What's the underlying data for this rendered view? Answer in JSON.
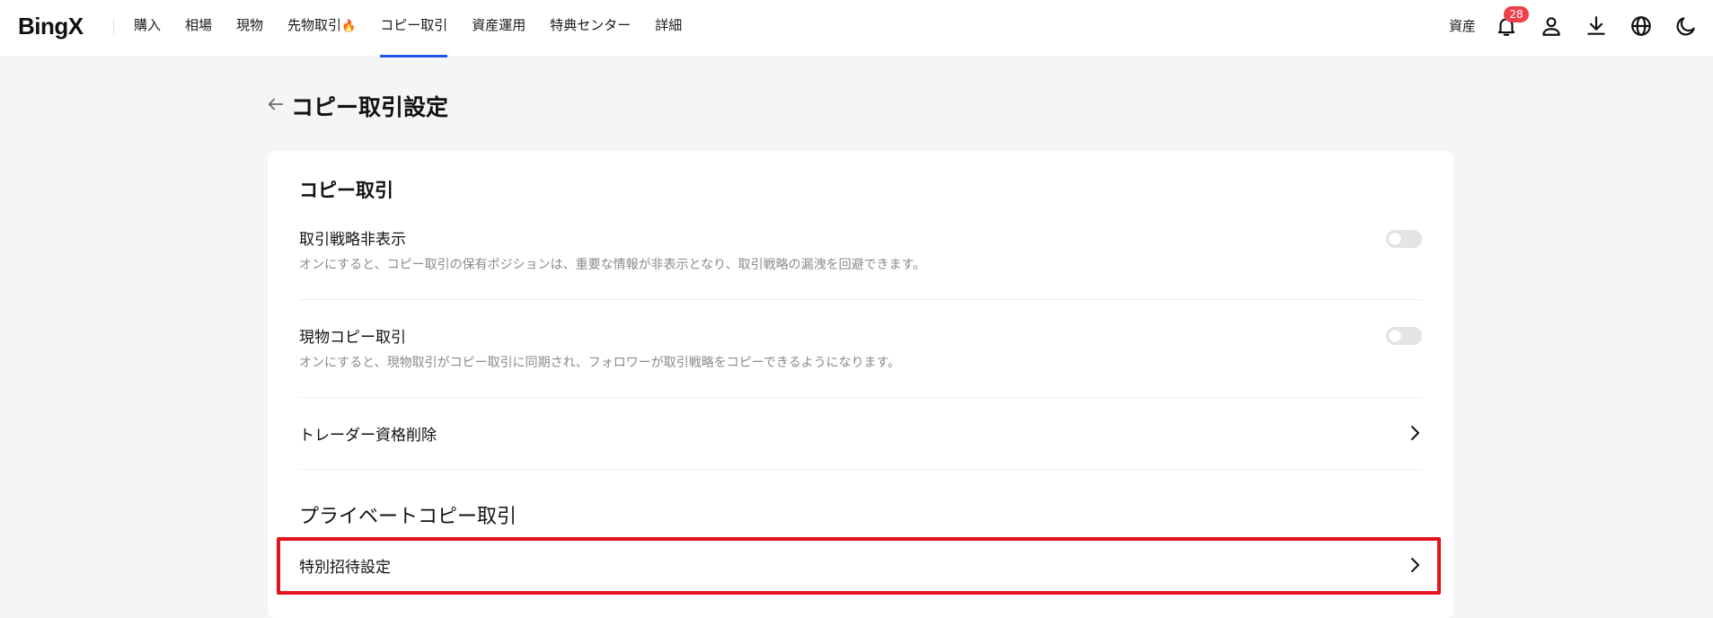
{
  "nav": {
    "logo": "BingX",
    "items": [
      {
        "label": "購入"
      },
      {
        "label": "相場"
      },
      {
        "label": "現物"
      },
      {
        "label": "先物取引",
        "icon": "fire-icon"
      },
      {
        "label": "コピー取引",
        "active": true
      },
      {
        "label": "資産運用"
      },
      {
        "label": "特典センター"
      },
      {
        "label": "詳細"
      }
    ],
    "right": {
      "assets_label": "資産",
      "notification_count": "28",
      "icons": [
        "bell-icon",
        "user-icon",
        "download-icon",
        "globe-icon",
        "moon-icon"
      ]
    },
    "accent_color": "#2354e6",
    "badge_color": "#f0404a"
  },
  "page": {
    "title": "コピー取引設定"
  },
  "sections": {
    "copy_trading": {
      "title": "コピー取引",
      "hide_strategy": {
        "title": "取引戦略非表示",
        "desc": "オンにすると、コピー取引の保有ポジションは、重要な情報が非表示となり、取引戦略の漏洩を回避できます。",
        "enabled": false
      },
      "spot_copy": {
        "title": "現物コピー取引",
        "desc": "オンにすると、現物取引がコピー取引に同期され、フォロワーが取引戦略をコピーできるようになります。",
        "enabled": false
      },
      "delete_qualification": {
        "title": "トレーダー資格削除"
      }
    },
    "private_copy_trading": {
      "title": "プライベートコピー取引",
      "special_invite": {
        "title": "特別招待設定"
      }
    }
  },
  "highlight_color": "#e3141e"
}
